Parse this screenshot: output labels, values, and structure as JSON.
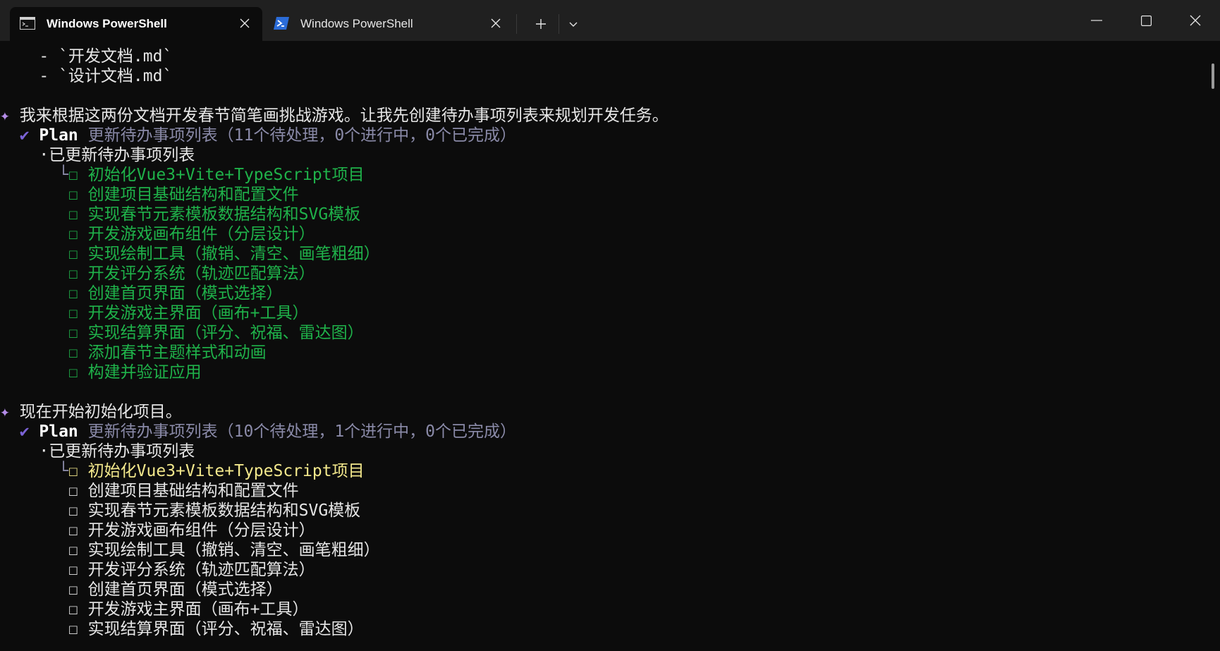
{
  "tabs": [
    {
      "label": "Windows PowerShell",
      "icon": "terminal-icon",
      "active": true
    },
    {
      "label": "Windows PowerShell",
      "icon": "powershell-icon",
      "active": false
    }
  ],
  "toolbar": {
    "new_tab": "+",
    "dropdown": "⌄"
  },
  "window_controls": {
    "minimize": "—",
    "maximize": "☐",
    "close": "✕"
  },
  "terminal": {
    "lines": [
      {
        "text": "    - `开发文档.md`",
        "color": "white"
      },
      {
        "text": "    - `设计文档.md`",
        "color": "white"
      },
      {
        "text": "",
        "color": "white"
      },
      {
        "prefix": "✦ ",
        "text": "我来根据这两份文档开发春节简笔画挑战游戏。让我先创建待办事项列表来规划开发任务。",
        "color": "white"
      },
      {
        "prefix": "  ✔ ",
        "label": "Plan",
        "text": " 更新待办事项列表（11个待处理，0个进行中，0个已完成）",
        "color": "muted"
      },
      {
        "text": "    ·已更新待办事项列表",
        "color": "white"
      },
      {
        "branch": "      └",
        "text": "☐ 初始化Vue3+Vite+TypeScript项目",
        "color": "green"
      },
      {
        "branch": "       ",
        "text": "☐ 创建项目基础结构和配置文件",
        "color": "green"
      },
      {
        "branch": "       ",
        "text": "☐ 实现春节元素模板数据结构和SVG模板",
        "color": "green"
      },
      {
        "branch": "       ",
        "text": "☐ 开发游戏画布组件（分层设计）",
        "color": "green"
      },
      {
        "branch": "       ",
        "text": "☐ 实现绘制工具（撤销、清空、画笔粗细）",
        "color": "green"
      },
      {
        "branch": "       ",
        "text": "☐ 开发评分系统（轨迹匹配算法）",
        "color": "green"
      },
      {
        "branch": "       ",
        "text": "☐ 创建首页界面（模式选择）",
        "color": "green"
      },
      {
        "branch": "       ",
        "text": "☐ 开发游戏主界面（画布+工具）",
        "color": "green"
      },
      {
        "branch": "       ",
        "text": "☐ 实现结算界面（评分、祝福、雷达图）",
        "color": "green"
      },
      {
        "branch": "       ",
        "text": "☐ 添加春节主题样式和动画",
        "color": "green"
      },
      {
        "branch": "       ",
        "text": "☐ 构建并验证应用",
        "color": "green"
      },
      {
        "text": "",
        "color": "white"
      },
      {
        "prefix": "✦ ",
        "text": "现在开始初始化项目。",
        "color": "white"
      },
      {
        "prefix": "  ✔ ",
        "label": "Plan",
        "text": " 更新待办事项列表（10个待处理，1个进行中，0个已完成）",
        "color": "muted"
      },
      {
        "text": "    ·已更新待办事项列表",
        "color": "white"
      },
      {
        "branch": "      └",
        "text": "☐ 初始化Vue3+Vite+TypeScript项目",
        "color": "yellow"
      },
      {
        "branch": "       ",
        "text": "☐ 创建项目基础结构和配置文件",
        "color": "white"
      },
      {
        "branch": "       ",
        "text": "☐ 实现春节元素模板数据结构和SVG模板",
        "color": "white"
      },
      {
        "branch": "       ",
        "text": "☐ 开发游戏画布组件（分层设计）",
        "color": "white"
      },
      {
        "branch": "       ",
        "text": "☐ 实现绘制工具（撤销、清空、画笔粗细）",
        "color": "white"
      },
      {
        "branch": "       ",
        "text": "☐ 开发评分系统（轨迹匹配算法）",
        "color": "white"
      },
      {
        "branch": "       ",
        "text": "☐ 创建首页界面（模式选择）",
        "color": "white"
      },
      {
        "branch": "       ",
        "text": "☐ 开发游戏主界面（画布+工具）",
        "color": "white"
      },
      {
        "branch": "       ",
        "text": "☐ 实现结算界面（评分、祝福、雷达图）",
        "color": "white"
      }
    ]
  }
}
